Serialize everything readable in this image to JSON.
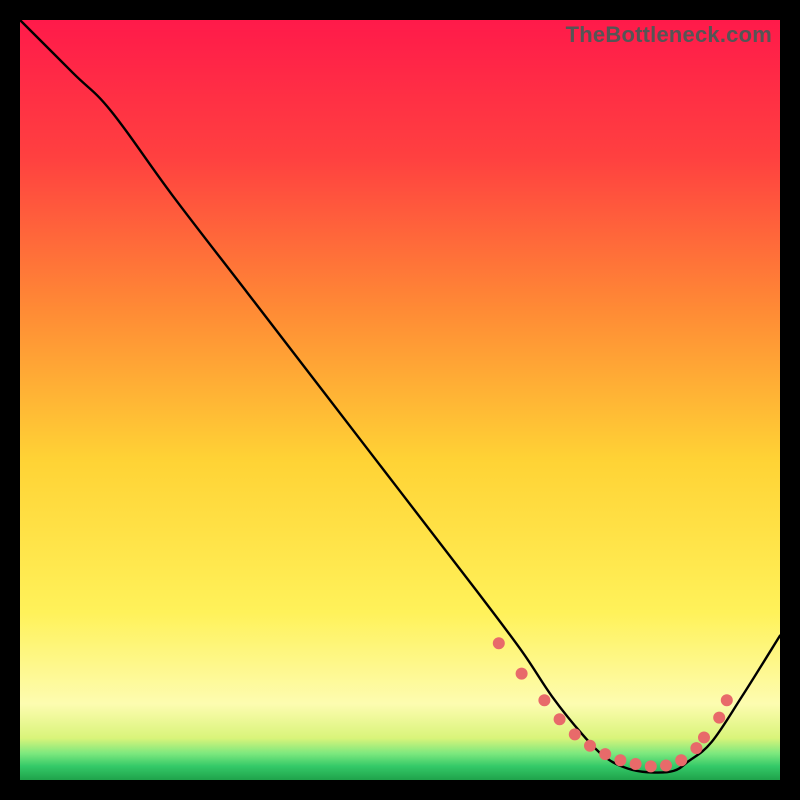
{
  "watermark": "TheBottleneck.com",
  "chart_data": {
    "type": "line",
    "title": "",
    "xlabel": "",
    "ylabel": "",
    "xlim": [
      0,
      100
    ],
    "ylim": [
      0,
      100
    ],
    "grid": false,
    "legend": false,
    "background_gradient": {
      "top": "#ff1a4a",
      "upper_mid": "#ff7b3a",
      "mid": "#ffd335",
      "lower_mid": "#fff88a",
      "green_band": "#4de07a",
      "bottom": "#1fa24a"
    },
    "series": [
      {
        "name": "bottleneck-curve",
        "color": "#000000",
        "x": [
          0,
          7,
          12,
          20,
          30,
          40,
          50,
          60,
          66,
          70,
          74,
          77,
          80,
          83,
          86,
          88,
          91,
          95,
          100
        ],
        "y": [
          100,
          93,
          88,
          77,
          64,
          51,
          38,
          25,
          17,
          11,
          6,
          3,
          1.5,
          1,
          1.2,
          2.5,
          5,
          11,
          19
        ]
      }
    ],
    "markers": {
      "color": "#e86a6a",
      "radius": 6,
      "x": [
        63,
        66,
        69,
        71,
        73,
        75,
        77,
        79,
        81,
        83,
        85,
        87,
        89,
        90,
        92,
        93
      ],
      "y": [
        18,
        14,
        10.5,
        8,
        6,
        4.5,
        3.4,
        2.6,
        2.1,
        1.8,
        1.9,
        2.6,
        4.2,
        5.6,
        8.2,
        10.5
      ]
    }
  }
}
